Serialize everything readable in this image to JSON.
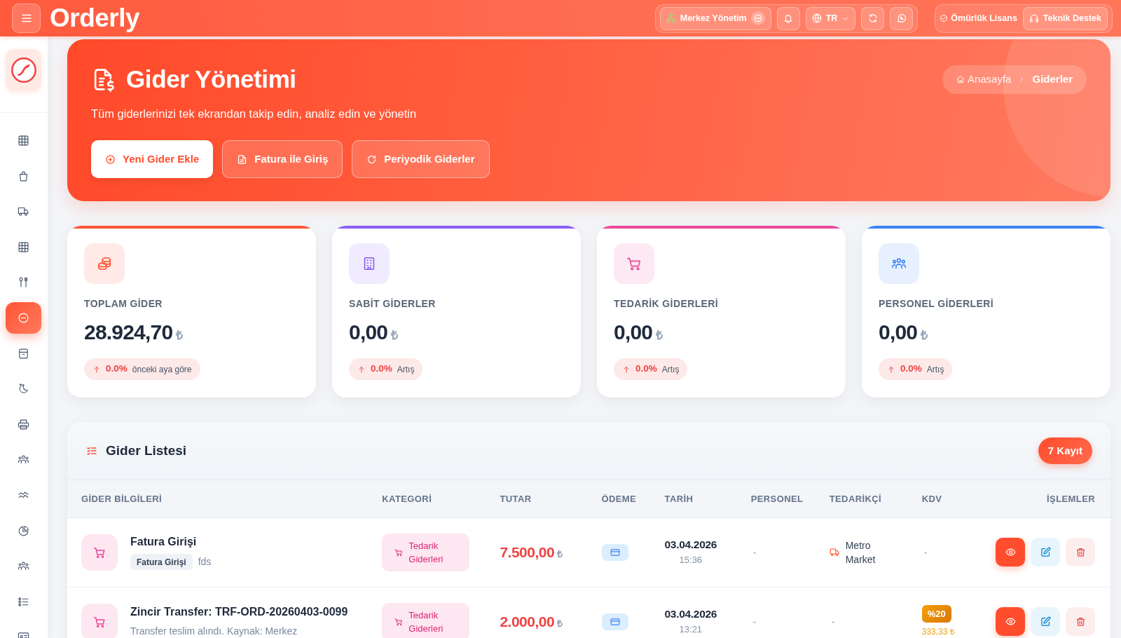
{
  "topbar": {
    "brand": "Orderly",
    "branch": "Merkez Yönetim",
    "language": "TR",
    "license": "Ömürlük Lisans",
    "support": "Teknik Destek"
  },
  "sidebar": {
    "items": [
      {
        "kind": "table",
        "selected": false
      },
      {
        "kind": "bag",
        "selected": false
      },
      {
        "kind": "truck",
        "selected": false
      },
      {
        "kind": "grid",
        "selected": false
      },
      {
        "kind": "cutlery",
        "selected": false
      },
      {
        "kind": "expense",
        "selected": true
      },
      {
        "kind": "box",
        "selected": false
      },
      {
        "kind": "moon",
        "selected": false
      },
      {
        "kind": "printer",
        "selected": false
      },
      {
        "kind": "people",
        "selected": false
      },
      {
        "kind": "chart",
        "selected": false
      },
      {
        "kind": "pie",
        "selected": false
      },
      {
        "kind": "team",
        "selected": false
      },
      {
        "kind": "list",
        "selected": false
      },
      {
        "kind": "idcard",
        "selected": false
      }
    ]
  },
  "hero": {
    "title": "Gider Yönetimi",
    "subtitle": "Tüm giderlerinizi tek ekrandan takip edin, analiz edin ve yönetin",
    "actions": [
      {
        "kind": "add",
        "label": "Yeni Gider Ekle"
      },
      {
        "kind": "invoice",
        "label": "Fatura ile Giriş"
      },
      {
        "kind": "recurring",
        "label": "Periyodik Giderler"
      }
    ],
    "breadcrumb": [
      {
        "label": "Anasayfa",
        "current": false
      },
      {
        "label": "Giderler",
        "current": true
      }
    ]
  },
  "stats": [
    {
      "kind": "total",
      "label": "TOPLAM GİDER",
      "value": "28.924,70",
      "currency": "₺",
      "change": "0.0%",
      "note": "önceki aya göre",
      "color": "#ff5436"
    },
    {
      "kind": "fixed",
      "label": "SABİT GİDERLER",
      "value": "0,00",
      "currency": "₺",
      "change": "0.0%",
      "note": "Artış",
      "color": "#8b5cf6"
    },
    {
      "kind": "supply",
      "label": "TEDARİK GİDERLERİ",
      "value": "0,00",
      "currency": "₺",
      "change": "0.0%",
      "note": "Artış",
      "color": "#ec4899"
    },
    {
      "kind": "staff",
      "label": "PERSONEL GİDERLERİ",
      "value": "0,00",
      "currency": "₺",
      "change": "0.0%",
      "note": "Artış",
      "color": "#3b82f6"
    }
  ],
  "expense_list": {
    "title": "Gider Listesi",
    "count": "7 Kayıt",
    "columns": [
      "GİDER BİLGİLERİ",
      "KATEGORİ",
      "TUTAR",
      "ÖDEME",
      "TARİH",
      "PERSONEL",
      "TEDARİKÇİ",
      "KDV",
      "İŞLEMLER"
    ],
    "rows": [
      {
        "title": "Fatura Girişi",
        "tag": "Fatura Girişi",
        "note": "fds",
        "category": {
          "kind": "supply",
          "label": "Tedarik Giderleri"
        },
        "amount": "7.500,00",
        "currency": "₺",
        "payment": {
          "kind": "card"
        },
        "date": "03.04.2026",
        "time": "15:36",
        "personnel": "-",
        "supplier": {
          "kind": "vendor",
          "name": "Metro Market"
        },
        "vat": {
          "kind": "none",
          "text": "-"
        }
      },
      {
        "title": "Zincir Transfer: TRF-ORD-20260403-0099",
        "note": "Transfer teslim alındı. Kaynak: Merkez",
        "category": {
          "kind": "supply",
          "label": "Tedarik Giderleri"
        },
        "amount": "2.000,00",
        "currency": "₺",
        "payment": {
          "kind": "card"
        },
        "date": "03.04.2026",
        "time": "13:21",
        "personnel": "-",
        "supplier": {
          "kind": "none",
          "name": "-"
        },
        "vat": {
          "kind": "rate",
          "rate": "%20",
          "amount": "333,33 ₺"
        }
      }
    ]
  }
}
